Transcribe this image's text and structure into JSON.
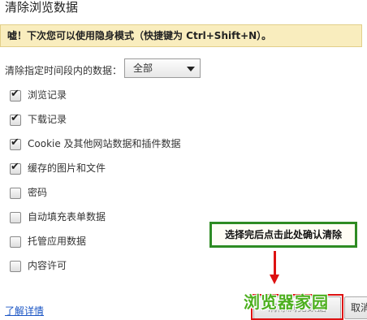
{
  "dialog": {
    "title": "清除浏览数据",
    "tip": "嘘！下次您可以使用隐身模式（快捷键为 Ctrl+Shift+N）。",
    "range_label": "清除指定时间段内的数据：",
    "range_value": "全部",
    "options": [
      {
        "label": "浏览记录",
        "checked": true
      },
      {
        "label": "下载记录",
        "checked": true
      },
      {
        "label": "Cookie 及其他网站数据和插件数据",
        "checked": true
      },
      {
        "label": "缓存的图片和文件",
        "checked": true
      },
      {
        "label": "密码",
        "checked": false
      },
      {
        "label": "自动填充表单数据",
        "checked": false
      },
      {
        "label": "托管应用数据",
        "checked": false
      },
      {
        "label": "内容许可",
        "checked": false
      }
    ],
    "learn_more": "了解详情",
    "clear_button": "清除浏览数据",
    "cancel_button": "取消"
  },
  "annotation": {
    "callout": "选择完后点击此处确认清除",
    "watermark": "浏览器家园",
    "arrow_color": "#dd1111",
    "callout_border": "#2e8b22"
  }
}
